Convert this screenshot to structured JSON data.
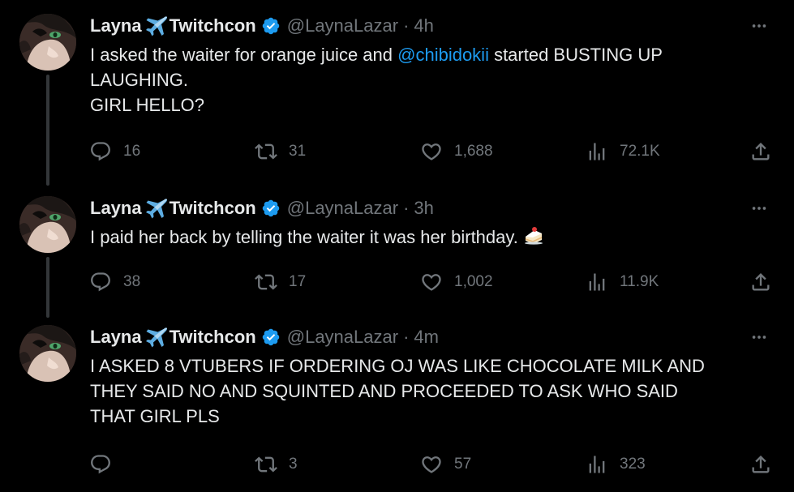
{
  "colors": {
    "background": "#000000",
    "text": "#e7e9ea",
    "muted": "#71767b",
    "accent": "#1d9bf0",
    "thread_line": "#333639"
  },
  "tweets": [
    {
      "name_part1": "Layna",
      "name_part2": "Twitchcon",
      "handle": "@LaynaLazar",
      "separator": "·",
      "time": "4h",
      "text_lines": [
        {
          "before": "I asked the waiter for orange juice and ",
          "mention": "@chibidokii",
          "after": " started BUSTING UP"
        },
        {
          "text": "LAUGHING."
        },
        {
          "text": "GIRL HELLO?"
        }
      ],
      "replies": "16",
      "reposts": "31",
      "likes": "1,688",
      "views": "72.1K"
    },
    {
      "name_part1": "Layna",
      "name_part2": "Twitchcon",
      "handle": "@LaynaLazar",
      "separator": "·",
      "time": "3h",
      "text_lines": [
        {
          "text": "I paid her back by telling the waiter it was her birthday."
        }
      ],
      "replies": "38",
      "reposts": "17",
      "likes": "1,002",
      "views": "11.9K"
    },
    {
      "name_part1": "Layna",
      "name_part2": "Twitchcon",
      "handle": "@LaynaLazar",
      "separator": "·",
      "time": "4m",
      "text_lines": [
        {
          "text": "I ASKED 8 VTUBERS IF ORDERING OJ WAS LIKE CHOCOLATE MILK AND"
        },
        {
          "text": "THEY SAID NO AND SQUINTED AND PROCEEDED TO ASK WHO SAID"
        },
        {
          "text": "THAT GIRL PLS"
        }
      ],
      "replies": "",
      "reposts": "3",
      "likes": "57",
      "views": "323"
    }
  ]
}
